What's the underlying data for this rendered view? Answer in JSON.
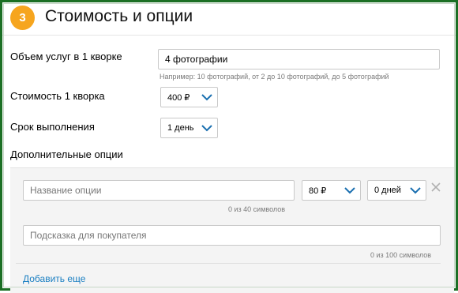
{
  "header": {
    "step_number": "3",
    "title": "Стоимость и опции"
  },
  "volume": {
    "label": "Объем услуг в 1 кворке",
    "value": "4 фотографии",
    "hint": "Например: 10 фотографий, от 2 до 10 фотографий, до 5 фотографий"
  },
  "price": {
    "label": "Стоимость 1 кворка",
    "value": "400 ₽"
  },
  "term": {
    "label": "Срок выполнения",
    "value": "1 день"
  },
  "options": {
    "label": "Дополнительные опции",
    "name_placeholder": "Название опции",
    "name_counter": "0 из 40 символов",
    "price_value": "80 ₽",
    "days_value": "0 дней",
    "hint_placeholder": "Подсказка для покупателя",
    "hint_counter": "0 из 100 символов",
    "add_more": "Добавить еще"
  },
  "colors": {
    "accent": "#f6a51e",
    "link": "#1a7fc2",
    "frame": "#1b6f24",
    "chevron": "#1a6fb0"
  },
  "icons": {
    "chevron": "chevron-down-icon",
    "close": "close-icon"
  }
}
